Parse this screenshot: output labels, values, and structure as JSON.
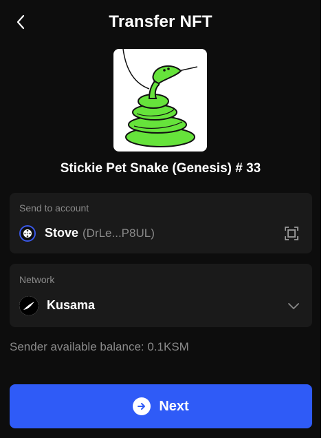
{
  "header": {
    "title": "Transfer NFT",
    "back_icon": "chevron-left-icon"
  },
  "nft": {
    "name": "Stickie Pet Snake (Genesis) # 33",
    "image": "snake-drawing"
  },
  "send_to": {
    "label": "Send to account",
    "account_name": "Stove",
    "account_address": "(DrLe...P8UL)",
    "scan_icon": "scan-qr-icon"
  },
  "network": {
    "label": "Network",
    "selected": "Kusama",
    "icon": "kusama-logo-icon",
    "dropdown_icon": "chevron-down-icon"
  },
  "balance": {
    "text": "Sender available balance: 0.1KSM"
  },
  "next_button": {
    "label": "Next",
    "icon": "arrow-right-circle-icon"
  },
  "colors": {
    "background": "#0d0d0d",
    "card": "#1a1a1a",
    "accent": "#2f5bf7",
    "muted_text": "#8a8a8a",
    "snake_green": "#66e33b"
  }
}
